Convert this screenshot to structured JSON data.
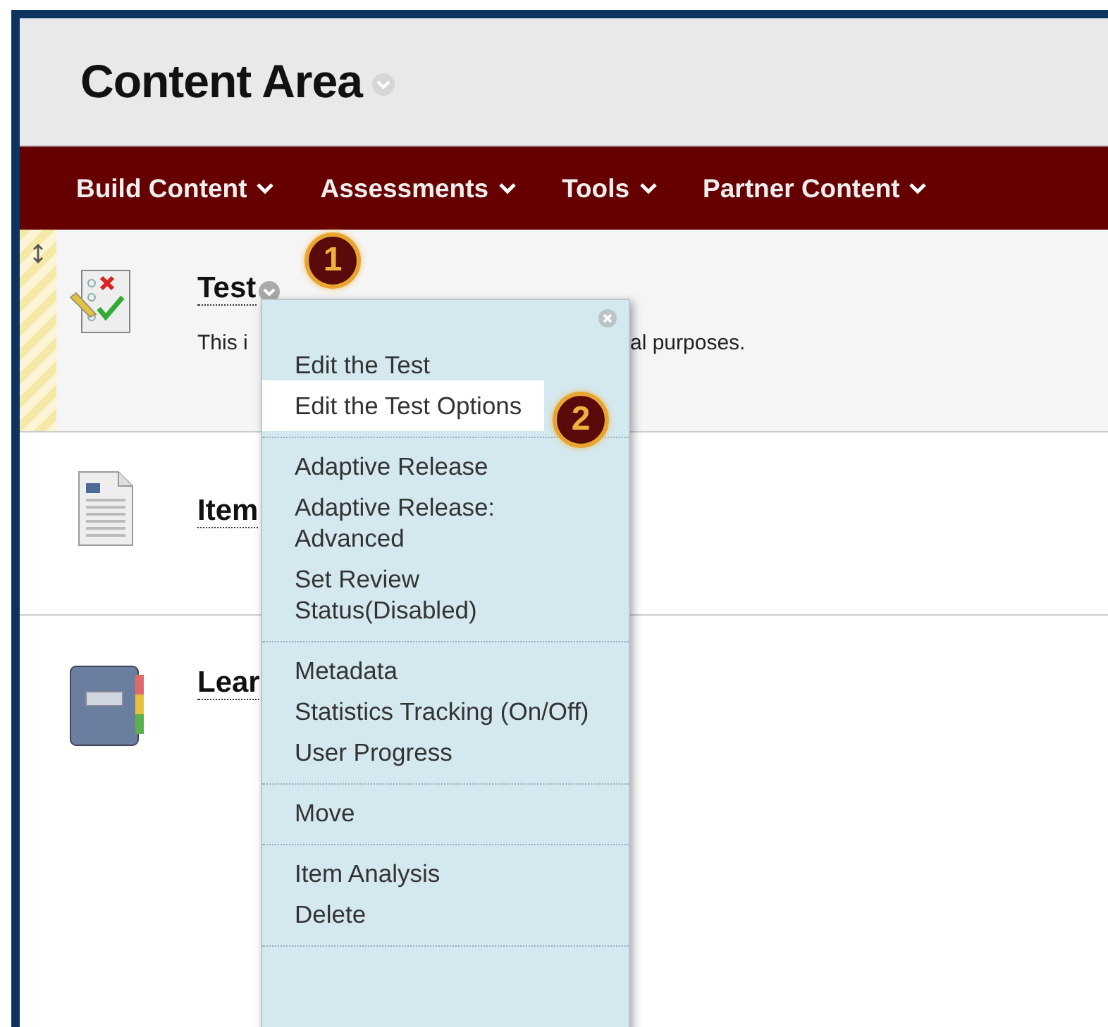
{
  "page_title": "Content Area",
  "nav": [
    {
      "label": "Build Content"
    },
    {
      "label": "Assessments"
    },
    {
      "label": "Tools"
    },
    {
      "label": "Partner Content"
    }
  ],
  "items": [
    {
      "title": "Test",
      "kind": "test",
      "highlighted": true,
      "description_start": "This i",
      "description_end": "al purposes."
    },
    {
      "title": "Item",
      "kind": "item",
      "highlighted": false
    },
    {
      "title": "Lear",
      "kind": "learning",
      "highlighted": false
    }
  ],
  "menu": {
    "groups": [
      [
        {
          "label": "Edit the Test",
          "selected": false
        },
        {
          "label": "Edit the Test Options",
          "selected": true
        }
      ],
      [
        {
          "label": "Adaptive Release",
          "selected": false
        },
        {
          "label": "Adaptive Release: Advanced",
          "selected": false
        },
        {
          "label": "Set Review Status(Disabled)",
          "selected": false
        }
      ],
      [
        {
          "label": "Metadata",
          "selected": false
        },
        {
          "label": "Statistics Tracking (On/Off)",
          "selected": false
        },
        {
          "label": "User Progress",
          "selected": false
        }
      ],
      [
        {
          "label": "Move",
          "selected": false
        }
      ],
      [
        {
          "label": "Item Analysis",
          "selected": false
        },
        {
          "label": "Delete",
          "selected": false
        }
      ]
    ]
  },
  "callouts": [
    "1",
    "2"
  ]
}
